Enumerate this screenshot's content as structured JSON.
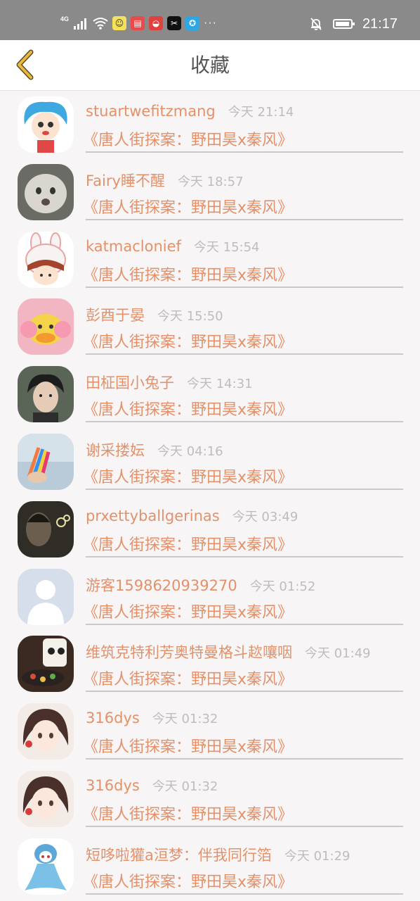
{
  "status_bar": {
    "network": "4G",
    "time": "21:17",
    "dots": "···",
    "icons": [
      "signal-icon",
      "wifi-icon",
      "notification-muted-icon",
      "battery-icon"
    ]
  },
  "header": {
    "title": "收藏",
    "back_icon": "chevron-left-icon",
    "accent_color": "#e9b93c"
  },
  "colors": {
    "name": "#e4916a",
    "time": "#bdbdbd",
    "divider": "#c9c9c9"
  },
  "items": [
    {
      "name": "stuartwefitzmang",
      "time": "今天 21:14",
      "title": "《唐人街探案：野田昊x秦风》"
    },
    {
      "name": "Fairy睡不醒",
      "time": "今天 18:57",
      "title": "《唐人街探案：野田昊x秦风》"
    },
    {
      "name": "katmaclonief",
      "time": "今天 15:54",
      "title": "《唐人街探案：野田昊x秦风》"
    },
    {
      "name": "彭酉于晏",
      "time": "今天 15:50",
      "title": "《唐人街探案：野田昊x秦风》"
    },
    {
      "name": "田柾国小兔子",
      "time": "今天 14:31",
      "title": "《唐人街探案：野田昊x秦风》"
    },
    {
      "name": "谢采搂妘",
      "time": "今天 04:16",
      "title": "《唐人街探案：野田昊x秦风》"
    },
    {
      "name": "prxettyballgerinas",
      "time": "今天 03:49",
      "title": "《唐人街探案：野田昊x秦风》"
    },
    {
      "name": "游客1598620939270",
      "time": "今天 01:52",
      "title": "《唐人街探案：野田昊x秦风》"
    },
    {
      "name": "维筑克特利芳奥特曼格斗趑嚷咽",
      "time": "今天 01:49",
      "title": "《唐人街探案：野田昊x秦风》"
    },
    {
      "name": "316dys",
      "time": "今天 01:32",
      "title": "《唐人街探案：野田昊x秦风》"
    },
    {
      "name": "316dys",
      "time": "今天 01:32",
      "title": "《唐人街探案：野田昊x秦风》"
    },
    {
      "name": "短哆啦獾a洹梦：伴我同行箔",
      "time": "今天 01:29",
      "title": "《唐人街探案：野田昊x秦风》"
    }
  ]
}
